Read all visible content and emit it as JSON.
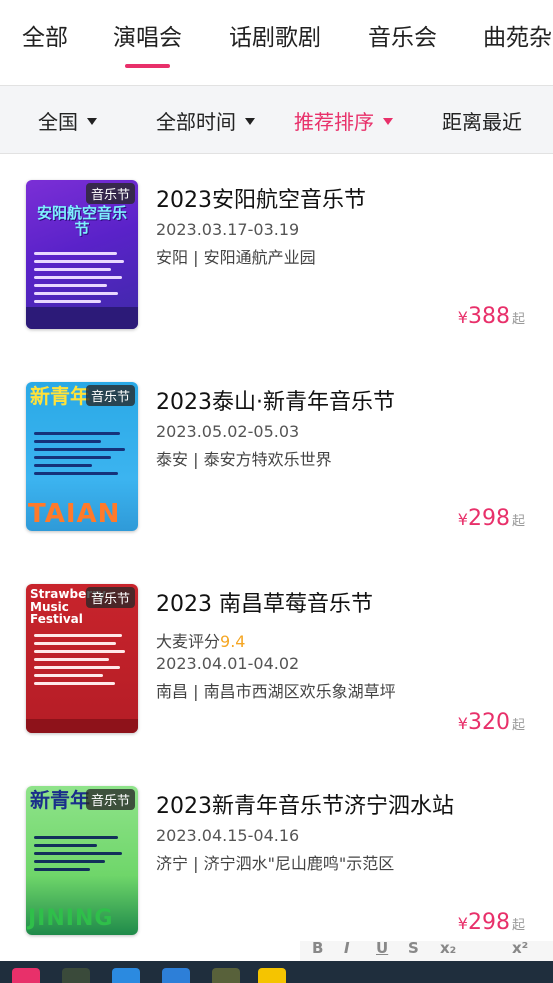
{
  "category_tabs": [
    "全部",
    "演唱会",
    "话剧歌剧",
    "音乐会",
    "曲苑杂"
  ],
  "filters": {
    "region": "全国",
    "time": "全部时间",
    "sort": "推荐排序",
    "distance": "距离最近"
  },
  "events": [
    {
      "tag": "音乐节",
      "poster_text": "安阳航空音乐节",
      "title": "2023安阳航空音乐节",
      "date": "2023.03.17-03.19",
      "venue": "安阳 | 安阳通航产业园",
      "price_symbol": "¥",
      "price": "388",
      "price_suffix": "起"
    },
    {
      "tag": "音乐节",
      "poster_text": "新青年",
      "poster_bottom": "TAIAN",
      "title": "2023泰山·新青年音乐节",
      "date": "2023.05.02-05.03",
      "venue": "泰安 | 泰安方特欢乐世界",
      "price_symbol": "¥",
      "price": "298",
      "price_suffix": "起"
    },
    {
      "tag": "音乐节",
      "poster_text": "Strawberry Music Festival",
      "title": "2023 南昌草莓音乐节",
      "rating_label": "大麦评分",
      "rating": "9.4",
      "date": "2023.04.01-04.02",
      "venue": "南昌 | 南昌市西湖区欢乐象湖草坪",
      "price_symbol": "¥",
      "price": "320",
      "price_suffix": "起"
    },
    {
      "tag": "音乐节",
      "poster_text": "新青年",
      "poster_bottom": "JINING",
      "title": "2023新青年音乐节济宁泗水站",
      "date": "2023.04.15-04.16",
      "venue": "济宁 | 济宁泗水\"尼山鹿鸣\"示范区",
      "price_symbol": "¥",
      "price": "298",
      "price_suffix": "起"
    }
  ],
  "colors": {
    "accent": "#e8306a",
    "rating": "#f5a623",
    "taskbar": "#1f2e3d"
  }
}
